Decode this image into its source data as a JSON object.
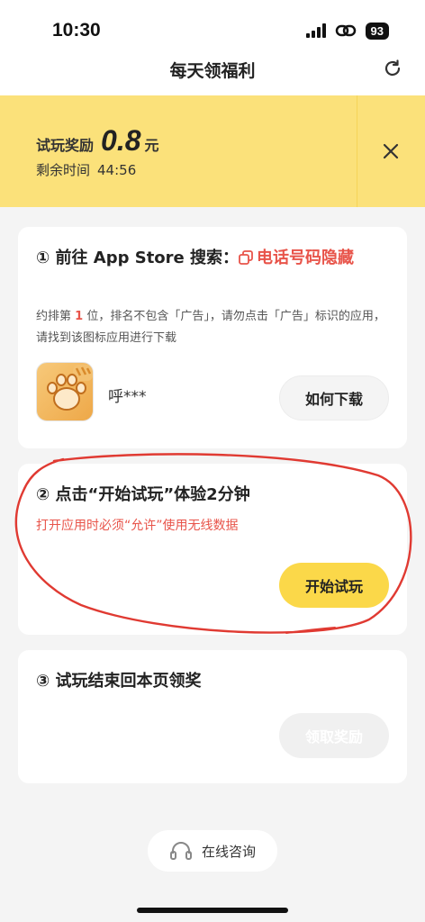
{
  "status_bar": {
    "time": "10:30",
    "battery": "93"
  },
  "nav": {
    "title": "每天领福利"
  },
  "reward": {
    "label": "试玩奖励",
    "amount": "0.8",
    "unit": "元",
    "remaining_label": "剩余时间",
    "remaining_time": "44:56"
  },
  "step1": {
    "title_prefix": "① 前往 App Store 搜索：",
    "title_keyword": "电话号码隐藏",
    "desc_prefix": "约排第 ",
    "desc_rank": "1",
    "desc_suffix": " 位，排名不包含「广告」，请勿点击「广告」标识的应用，请找到该图标应用进行下载",
    "app_name": "呼***",
    "how_download_label": "如何下载"
  },
  "step2": {
    "title": "② 点击“开始试玩”体验2分钟",
    "desc": "打开应用时必须“允许”使用无线数据",
    "start_label": "开始试玩"
  },
  "step3": {
    "title": "③ 试玩结束回本页领奖",
    "claim_label": "领取奖励"
  },
  "footer": {
    "consult_label": "在线咨询"
  },
  "colors": {
    "accent_yellow": "#fbd849",
    "banner": "#fbe17a",
    "red": "#e8544a",
    "annotation": "#e03a32"
  }
}
